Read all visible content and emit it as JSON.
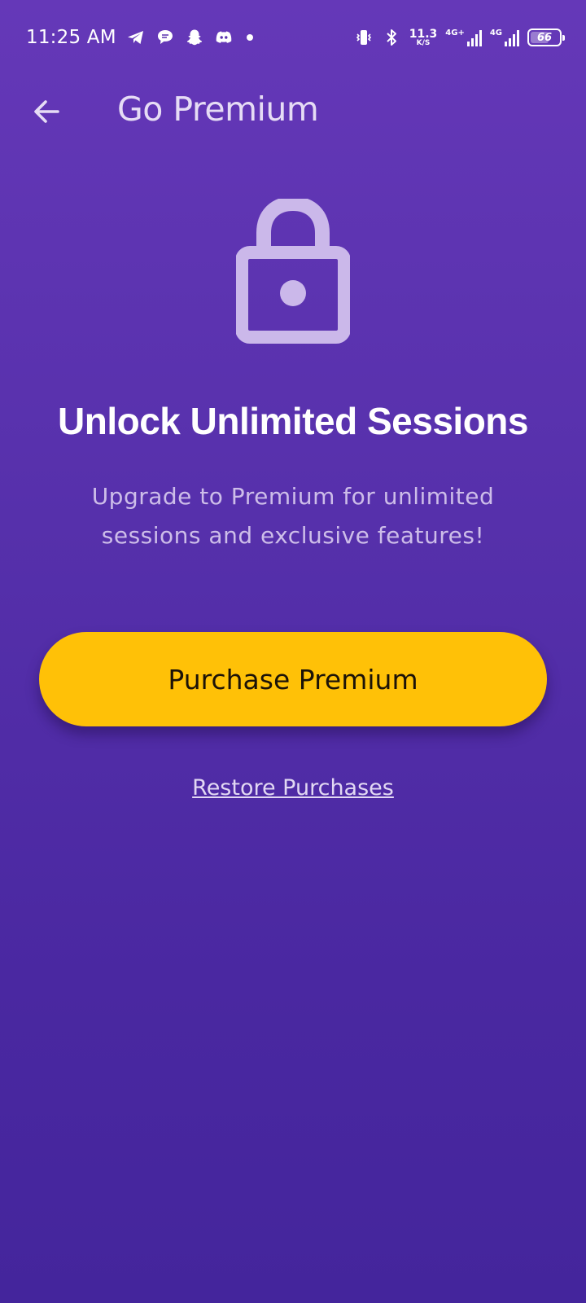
{
  "status_bar": {
    "time": "11:25 AM",
    "left_icons": [
      "telegram-icon",
      "chat-bubble-icon",
      "snapchat-icon",
      "discord-icon"
    ],
    "net_speed_value": "11.3",
    "net_speed_unit": "K/S",
    "sim1_label": "4G+",
    "sim2_label": "4G",
    "battery_percent": "66"
  },
  "app_bar": {
    "title": "Go Premium"
  },
  "main": {
    "headline": "Unlock Unlimited Sessions",
    "subtitle": "Upgrade to Premium for unlimited sessions and exclusive features!",
    "purchase_label": "Purchase Premium",
    "restore_label": "Restore Purchases"
  },
  "colors": {
    "background_top": "#6538b8",
    "background_bottom": "#44259c",
    "accent_button": "#ffc107",
    "lock_icon": "#cbb8ea"
  }
}
